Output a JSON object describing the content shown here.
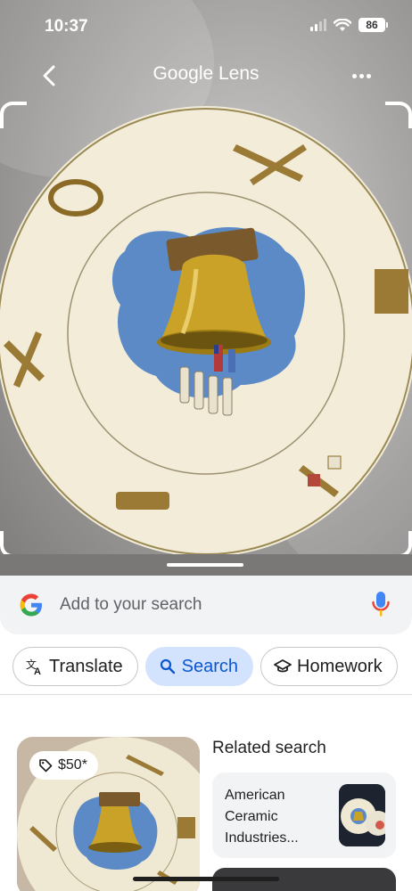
{
  "status_bar": {
    "time": "10:37",
    "battery": "86"
  },
  "header": {
    "title": "Google Lens",
    "back_icon": "chevron-left-icon",
    "more_icon": "more-horizontal-icon"
  },
  "search": {
    "placeholder": "Add to your search",
    "logo_icon": "google-g-icon",
    "mic_icon": "mic-icon"
  },
  "chips": [
    {
      "label": "Translate",
      "icon": "translate-icon",
      "active": false
    },
    {
      "label": "Search",
      "icon": "search-icon",
      "active": true
    },
    {
      "label": "Homework",
      "icon": "graduation-cap-icon",
      "active": false
    }
  ],
  "results": {
    "price": "$50*",
    "price_icon": "tag-icon",
    "related_title": "Related search",
    "related_item": "American Ceramic Industries..."
  },
  "colors": {
    "accent": "#0b57d0",
    "chip_active_bg": "#d3e3fd",
    "plate_blue": "#5b8ac7",
    "bell_gold": "#c9a227"
  }
}
